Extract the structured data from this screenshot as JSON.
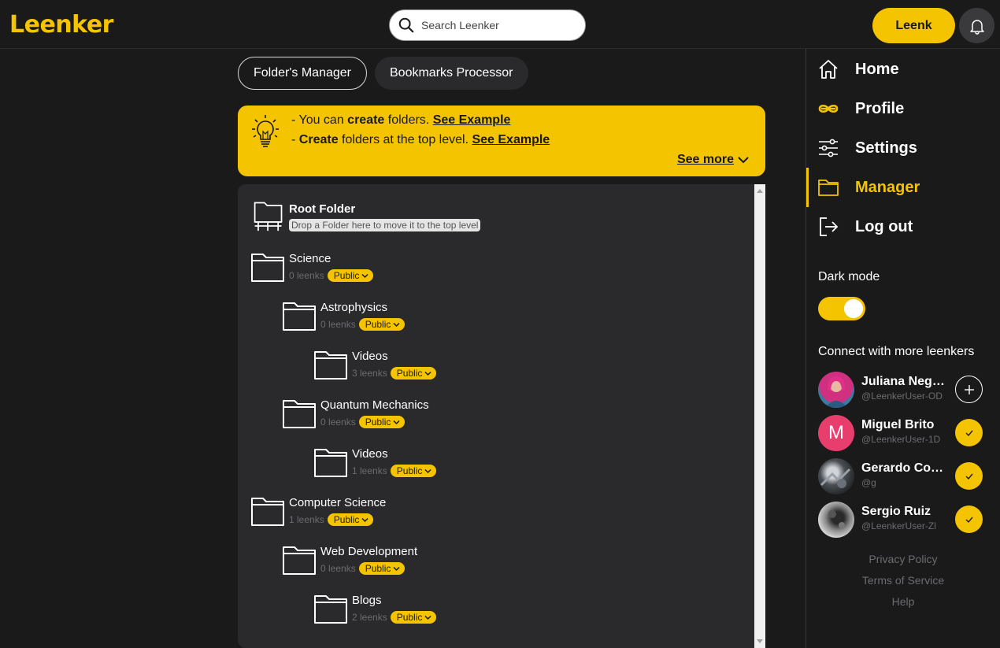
{
  "brand": {
    "logo": "Leenker",
    "accent": "#f5c400"
  },
  "header": {
    "search_placeholder": "Search Leenker",
    "leenk_label": "Leenk",
    "notifications_icon": "bell-icon"
  },
  "tabs": [
    {
      "label": "Folder's Manager",
      "active": true
    },
    {
      "label": "Bookmarks Processor",
      "active": false
    }
  ],
  "tip": {
    "line1": {
      "prefix": "- You can ",
      "bold": "create",
      "suffix": " folders. ",
      "link": "See Example"
    },
    "line2": {
      "prefix": "- ",
      "bold": "Create",
      "suffix": " folders at the top level. ",
      "link": "See Example"
    },
    "see_more": "See more"
  },
  "tree": {
    "root": {
      "name": "Root Folder",
      "hint": "Drop a Folder here to move it to the top level"
    },
    "folders": [
      {
        "name": "Science",
        "count": "0 leenks",
        "visibility": "Public"
      },
      {
        "name": "Astrophysics",
        "count": "0 leenks",
        "visibility": "Public"
      },
      {
        "name": "Videos",
        "count": "3 leenks",
        "visibility": "Public"
      },
      {
        "name": "Quantum Mechanics",
        "count": "0 leenks",
        "visibility": "Public"
      },
      {
        "name": "Videos",
        "count": "1 leenks",
        "visibility": "Public"
      },
      {
        "name": "Computer Science",
        "count": "1 leenks",
        "visibility": "Public"
      },
      {
        "name": "Web Development",
        "count": "0 leenks",
        "visibility": "Public"
      },
      {
        "name": "Blogs",
        "count": "2 leenks",
        "visibility": "Public"
      }
    ]
  },
  "sidebar": {
    "nav": [
      {
        "label": "Home",
        "icon": "home-icon"
      },
      {
        "label": "Profile",
        "icon": "profile-icon"
      },
      {
        "label": "Settings",
        "icon": "sliders-icon"
      },
      {
        "label": "Manager",
        "icon": "folder-icon",
        "active": true
      },
      {
        "label": "Log out",
        "icon": "logout-icon"
      }
    ],
    "dark_mode_label": "Dark mode",
    "dark_mode_on": true,
    "connect_label": "Connect with more leenkers",
    "users": [
      {
        "name": "Juliana Negrete",
        "handle": "@LeenkerUser-OD",
        "action": "add"
      },
      {
        "name": "Miguel Brito",
        "handle": "@LeenkerUser-1D",
        "initial": "M",
        "action": "connected"
      },
      {
        "name": "Gerardo Cortes",
        "handle": "@g",
        "action": "connected"
      },
      {
        "name": "Sergio Ruiz",
        "handle": "@LeenkerUser-Zl",
        "action": "connected"
      }
    ],
    "footer": [
      "Privacy Policy",
      "Terms of Service",
      "Help"
    ]
  }
}
